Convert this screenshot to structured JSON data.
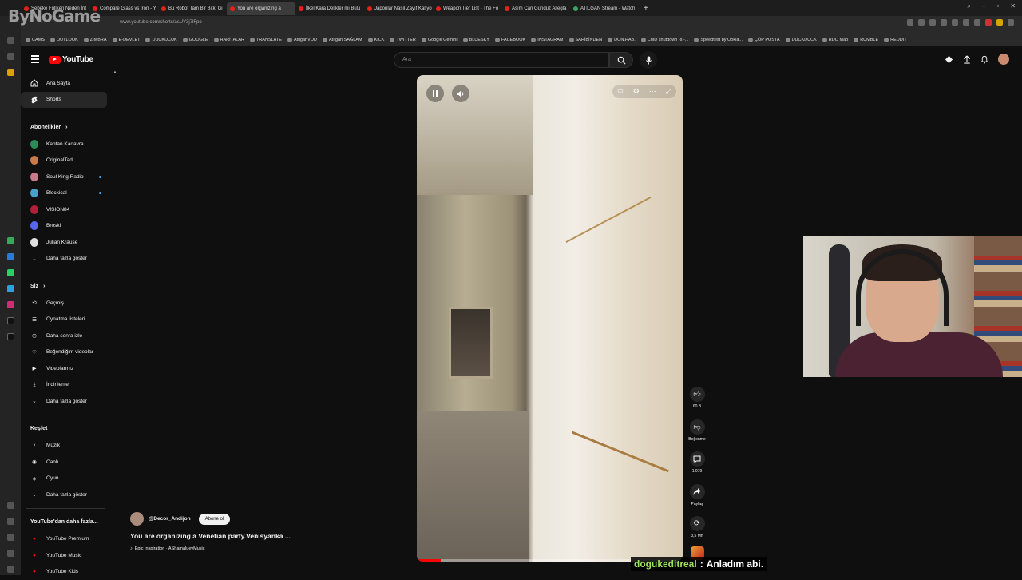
{
  "browser": {
    "tabs": [
      {
        "title": "Şebeke Fullken Neden İnt"
      },
      {
        "title": "Compare Glass vs Iron - Y"
      },
      {
        "title": "Bu Robot Tam Bir Bitki Gi"
      },
      {
        "title": "You are organizing a",
        "active": true
      },
      {
        "title": "İlkel Kara Delikler mi Bulu"
      },
      {
        "title": "Japonlar Nasıl Zayıf Kalıyo"
      },
      {
        "title": "Weapon Tier List - The Fo"
      },
      {
        "title": "Asım Can Gündüz Allegla"
      },
      {
        "title": "ATILGAN Stream - Watch"
      }
    ],
    "url": "www.youtube.com/shorts/asUY3j7lFpo",
    "bookmarks": [
      "CAMS",
      "OUTLOOK",
      "ZIMBRA",
      "E-DEVLET",
      "DUCKDCUK",
      "GOOGLE",
      "HARİTALAR",
      "TRANSLATE",
      "AtılganVOD",
      "Atılgan SAĞLAM",
      "KICK",
      "TWITTER",
      "Google Gemini",
      "BLUESKY",
      "FACEBOOK",
      "INSTAGRAM",
      "SAHİBİNDEN",
      "DON.HAB.",
      "CMD shutdown -s -...",
      "Speedtest by Ookla...",
      "ÇÖP POSTA",
      "DUCKDUCK",
      "RDO Map",
      "RUMBLE",
      "REDDIT"
    ]
  },
  "watermark": "ByNoGame",
  "header": {
    "logo_text": "YouTube",
    "search_placeholder": "Ara"
  },
  "sidebar": {
    "main": [
      {
        "label": "Ana Sayfa",
        "icon": "home-icon"
      },
      {
        "label": "Shorts",
        "icon": "shorts-icon",
        "active": true
      }
    ],
    "subscriptions_title": "Abonelikler",
    "subscriptions": [
      {
        "label": "Kaptan Kadavra",
        "color": "#2e8b57",
        "dot": false
      },
      {
        "label": "OriginalTad",
        "color": "#c97a4a",
        "dot": false
      },
      {
        "label": "Soul King Radio",
        "color": "#c77b8a",
        "dot": true
      },
      {
        "label": "Blockical",
        "color": "#4aa0c9",
        "dot": true
      },
      {
        "label": "VISION84",
        "color": "#b0203a",
        "dot": false
      },
      {
        "label": "Broski",
        "color": "#5865f2",
        "dot": false
      },
      {
        "label": "Julian Krause",
        "color": "#e0e0e0",
        "dot": false
      }
    ],
    "show_more": "Daha fazla göster",
    "you_title": "Siz",
    "you": [
      {
        "label": "Geçmiş",
        "icon": "history-icon"
      },
      {
        "label": "Oynatma listeleri",
        "icon": "playlists-icon"
      },
      {
        "label": "Daha sonra izle",
        "icon": "watch-later-icon"
      },
      {
        "label": "Beğendiğim videolar",
        "icon": "liked-icon"
      },
      {
        "label": "Videolarınız",
        "icon": "your-videos-icon"
      },
      {
        "label": "İndirilenler",
        "icon": "downloads-icon"
      }
    ],
    "explore_title": "Keşfet",
    "explore": [
      {
        "label": "Müzik",
        "icon": "music-icon"
      },
      {
        "label": "Canlı",
        "icon": "live-icon"
      },
      {
        "label": "Oyun",
        "icon": "gaming-icon"
      }
    ],
    "more_title": "YouTube'dan daha fazla...",
    "more": [
      {
        "label": "YouTube Premium"
      },
      {
        "label": "YouTube Music"
      },
      {
        "label": "YouTube Kids"
      }
    ]
  },
  "video": {
    "channel": "@Decor_Andijon",
    "subscribe": "Abone ol",
    "title": "You are organizing a Venetian party.Venisyanka ...",
    "music": "Epic Inspiration · AShamaluevMusic",
    "progress": 0.09
  },
  "actions": {
    "likes": "60 B",
    "dislike": "Beğenme",
    "comments": "1.079",
    "share": "Paylaş",
    "remix": "3,5 Mn"
  },
  "chat": {
    "user": "dogukeditreal",
    "message": "Anladım abi."
  }
}
